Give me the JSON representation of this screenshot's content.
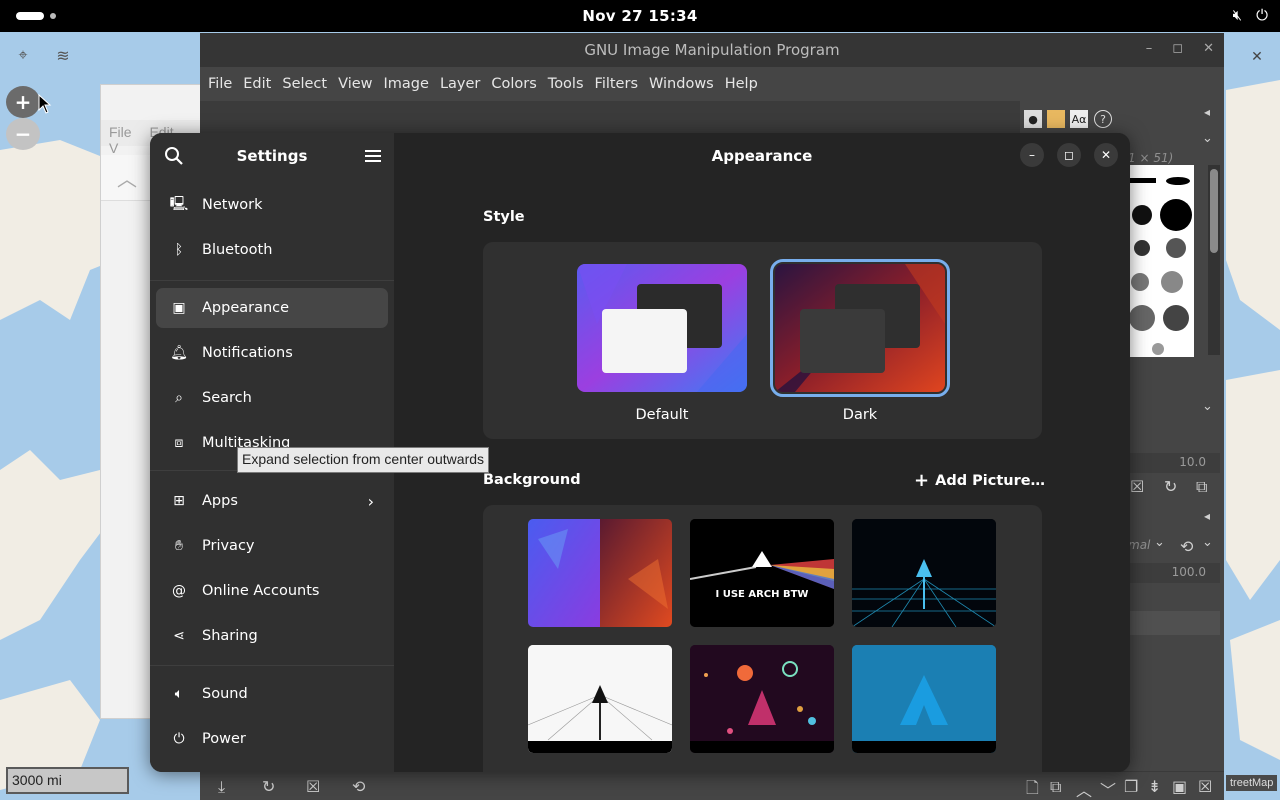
{
  "topbar": {
    "clock": "Nov 27  15:34"
  },
  "map": {
    "scale": "3000 mi",
    "attribution": "treetMap"
  },
  "bg_window": {
    "menu": [
      "File",
      "Edit",
      "V"
    ]
  },
  "gimp": {
    "title": "GNU Image Manipulation Program",
    "menu": [
      "File",
      "Edit",
      "Select",
      "View",
      "Image",
      "Layer",
      "Colors",
      "Tools",
      "Filters",
      "Windows",
      "Help"
    ],
    "brush_size_label": "1 × 51)",
    "spacing_value": "10.0",
    "mode_label": "mal",
    "opacity_value": "100.0"
  },
  "settings": {
    "sidebar_title": "Settings",
    "content_title": "Appearance",
    "nav": [
      {
        "label": "Network",
        "icon": "network-icon"
      },
      {
        "label": "Bluetooth",
        "icon": "bluetooth-icon"
      },
      {
        "label": "Appearance",
        "icon": "appearance-icon",
        "active": true
      },
      {
        "label": "Notifications",
        "icon": "bell-icon"
      },
      {
        "label": "Search",
        "icon": "search-icon"
      },
      {
        "label": "Multitasking",
        "icon": "multitasking-icon"
      },
      {
        "label": "Apps",
        "icon": "apps-icon",
        "has_arrow": true
      },
      {
        "label": "Privacy",
        "icon": "hand-icon"
      },
      {
        "label": "Online Accounts",
        "icon": "at-icon"
      },
      {
        "label": "Sharing",
        "icon": "share-icon"
      },
      {
        "label": "Sound",
        "icon": "speaker-icon"
      },
      {
        "label": "Power",
        "icon": "power-icon"
      }
    ],
    "style_heading": "Style",
    "style_options": [
      {
        "label": "Default",
        "selected": false
      },
      {
        "label": "Dark",
        "selected": true
      }
    ],
    "background_heading": "Background",
    "add_picture": "Add Picture…",
    "wallpapers": [
      {
        "name": "geometric-split-wallpaper"
      },
      {
        "name": "arch-prism-wallpaper",
        "text": "I USE ARCH BTW"
      },
      {
        "name": "arch-neon-grid-wallpaper"
      },
      {
        "name": "arch-white-road-wallpaper"
      },
      {
        "name": "arch-planets-wallpaper"
      },
      {
        "name": "arch-blue-wallpaper"
      }
    ]
  },
  "tooltip": {
    "text": "Expand selection from center outwards"
  },
  "colors": {
    "accent": "#78aeed",
    "sidebar": "#303030",
    "content": "#242424"
  }
}
